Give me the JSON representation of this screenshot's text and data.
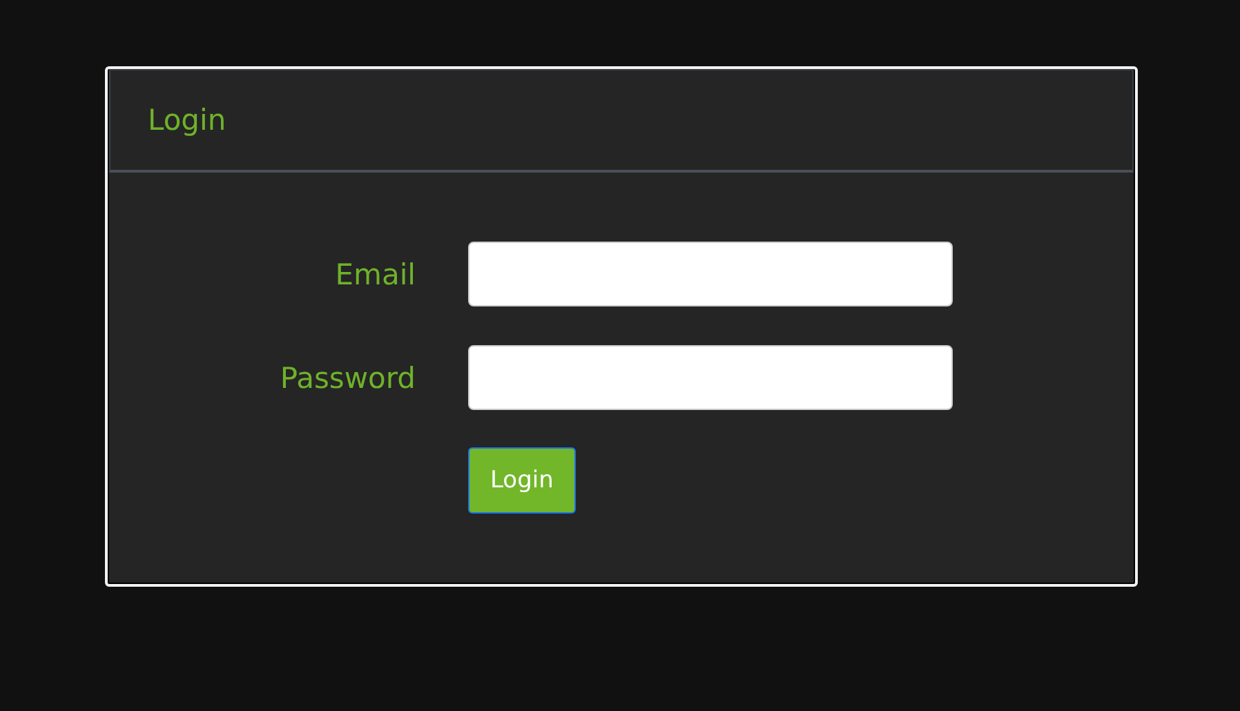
{
  "panel": {
    "title": "Login"
  },
  "fields": [
    {
      "label": "Email"
    },
    {
      "label": "Password"
    }
  ],
  "button": {
    "label": "Login"
  }
}
